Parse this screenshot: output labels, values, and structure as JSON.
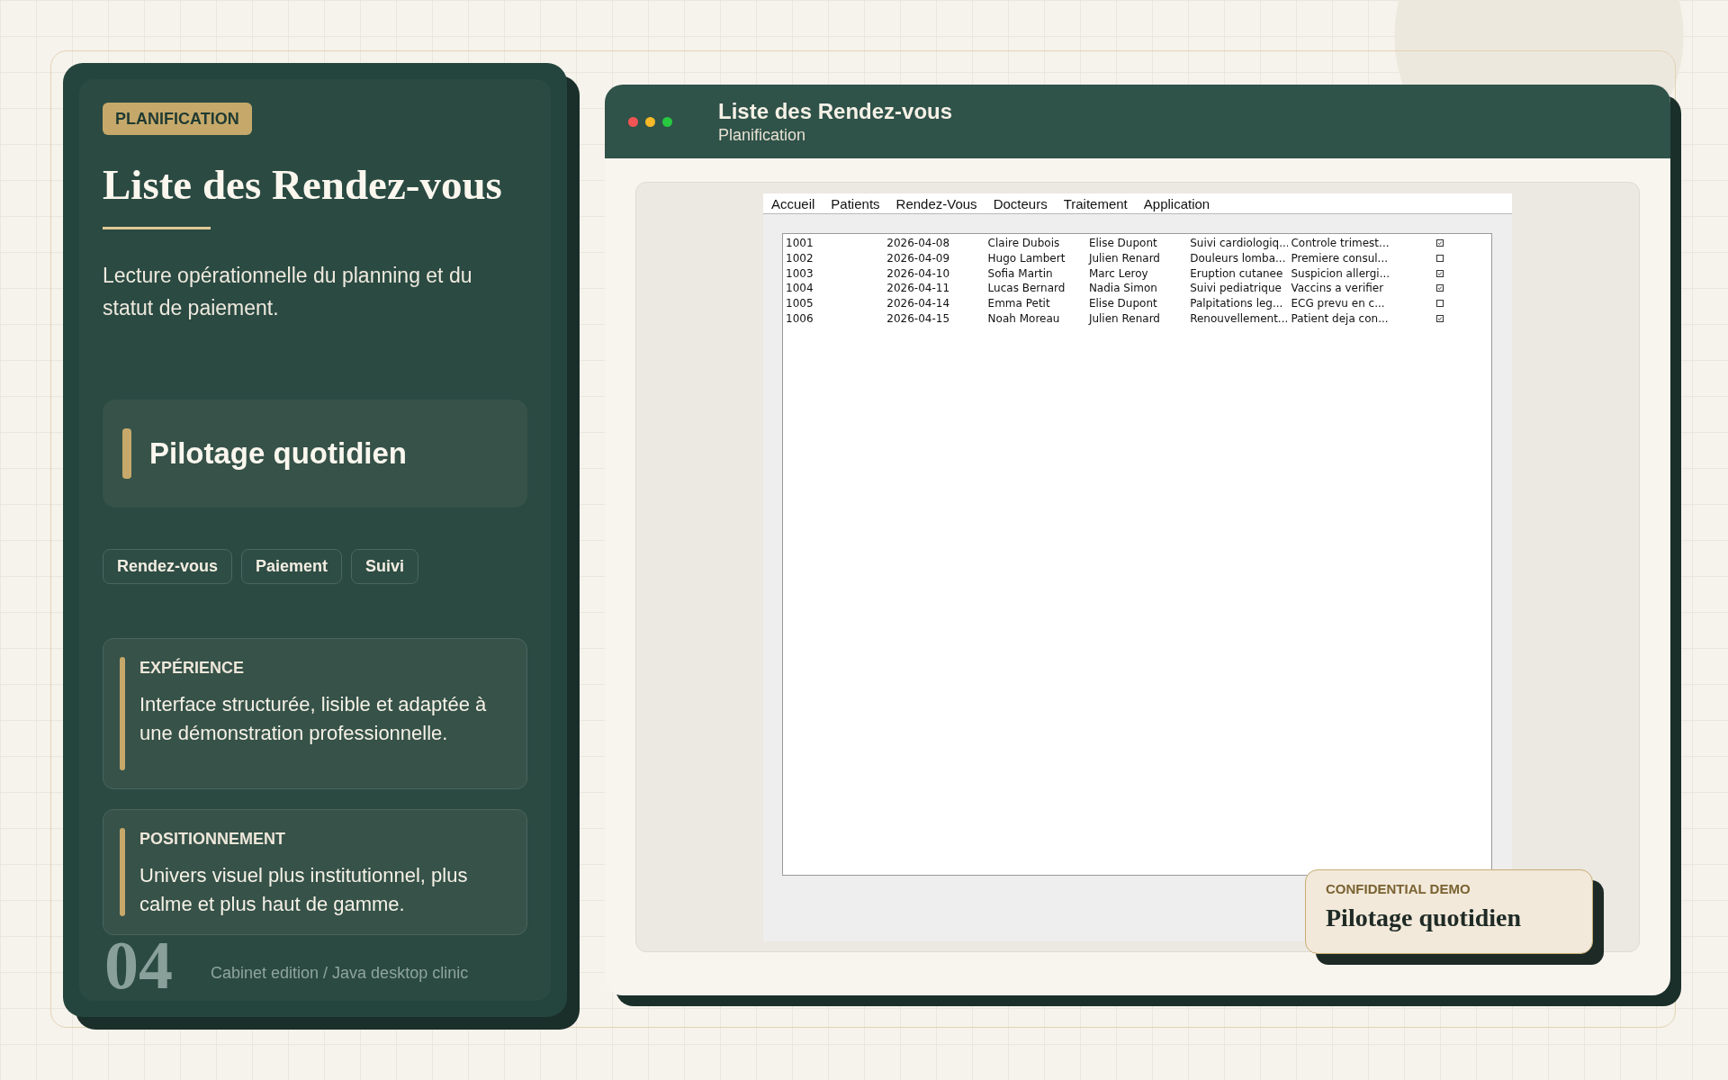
{
  "sidebar": {
    "badge": "PLANIFICATION",
    "title": "Liste des Rendez-vous",
    "description": "Lecture opérationnelle du planning et du statut de paiement.",
    "highlight": "Pilotage quotidien",
    "tags": [
      "Rendez-vous",
      "Paiement",
      "Suivi"
    ],
    "notes": [
      {
        "heading": "EXPÉRIENCE",
        "text": "Interface structurée, lisible et adaptée à une démonstration professionnelle."
      },
      {
        "heading": "POSITIONNEMENT",
        "text": "Univers visuel plus institutionnel, plus calme et plus haut de gamme."
      }
    ],
    "page_number": "04",
    "caption": "Cabinet edition / Java desktop clinic"
  },
  "window": {
    "title": "Liste des Rendez-vous",
    "subtitle": "Planification",
    "menu": [
      "Accueil",
      "Patients",
      "Rendez-Vous",
      "Docteurs",
      "Traitement",
      "Application"
    ],
    "table": {
      "rows": [
        {
          "cells": [
            "1001",
            "2026-04-08",
            "Claire Dubois",
            "Elise Dupont",
            "Suivi cardiologiq...",
            "Controle trimest..."
          ],
          "checked": true
        },
        {
          "cells": [
            "1002",
            "2026-04-09",
            "Hugo Lambert",
            "Julien Renard",
            "Douleurs lomba...",
            "Premiere consul..."
          ],
          "checked": false
        },
        {
          "cells": [
            "1003",
            "2026-04-10",
            "Sofia Martin",
            "Marc Leroy",
            "Eruption cutanee",
            "Suspicion allergi..."
          ],
          "checked": true
        },
        {
          "cells": [
            "1004",
            "2026-04-11",
            "Lucas Bernard",
            "Nadia Simon",
            "Suivi pediatrique",
            "Vaccins a verifier"
          ],
          "checked": true
        },
        {
          "cells": [
            "1005",
            "2026-04-14",
            "Emma Petit",
            "Elise Dupont",
            "Palpitations leg...",
            "ECG prevu en c..."
          ],
          "checked": false
        },
        {
          "cells": [
            "1006",
            "2026-04-15",
            "Noah Moreau",
            "Julien Renard",
            "Renouvellement...",
            "Patient deja con..."
          ],
          "checked": true
        }
      ]
    }
  },
  "overlay_card": {
    "label": "CONFIDENTIAL DEMO",
    "title": "Pilotage quotidien"
  }
}
